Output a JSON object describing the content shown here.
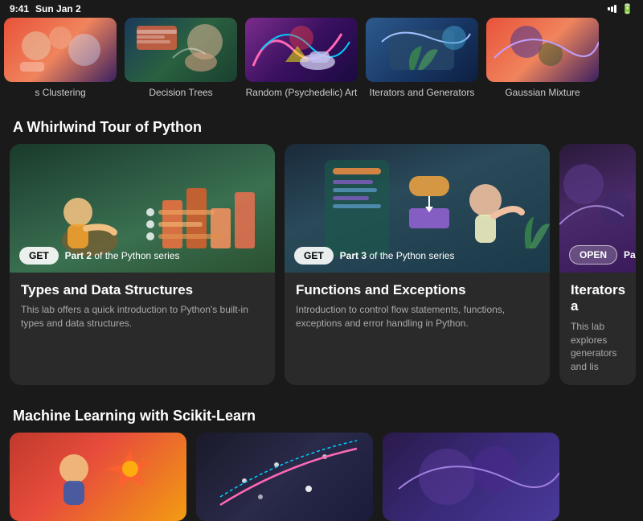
{
  "statusBar": {
    "time": "9:41",
    "date": "Sun Jan 2"
  },
  "topCards": [
    {
      "id": "clustering",
      "label": "s Clustering",
      "colorClass": "illus-1"
    },
    {
      "id": "decision-trees",
      "label": "Decision Trees",
      "colorClass": "illus-2"
    },
    {
      "id": "random-art",
      "label": "Random (Psychedelic) Art",
      "colorClass": "illus-3"
    },
    {
      "id": "iterators",
      "label": "Iterators and Generators",
      "colorClass": "illus-4"
    },
    {
      "id": "gaussian",
      "label": "Gaussian Mixture",
      "colorClass": "illus-1"
    }
  ],
  "sections": [
    {
      "id": "python-whirlwind",
      "title": "A Whirlwind Tour of Python",
      "cards": [
        {
          "id": "types-data",
          "colorClass": "illus-tds",
          "badgeType": "get",
          "badgeLabel": "GET",
          "seriesPart": "Part 2",
          "seriesName": "the Python series",
          "title": "Types and Data Structures",
          "desc": "This lab offers a quick introduction to Python's built-in types and data structures."
        },
        {
          "id": "functions-exceptions",
          "colorClass": "illus-fe",
          "badgeType": "get",
          "badgeLabel": "GET",
          "seriesPart": "Part 3",
          "seriesName": "the Python series",
          "title": "Functions and Exceptions",
          "desc": "Introduction to control flow statements, functions, exceptions and error handling in Python."
        },
        {
          "id": "iterators-partial",
          "colorClass": "illus-iter",
          "badgeType": "open",
          "badgeLabel": "OPEN",
          "seriesPart": "Par",
          "seriesName": "",
          "title": "Iterators a",
          "desc": "This lab explores generators and lis"
        }
      ]
    }
  ],
  "bottomSection": {
    "title": "Machine Learning with Scikit-Learn",
    "cards": [
      {
        "id": "ml1",
        "colorClass": "illus-ml1"
      },
      {
        "id": "ml2",
        "colorClass": "illus-ml2"
      },
      {
        "id": "ml3",
        "colorClass": "illus-ml3"
      }
    ]
  },
  "labels": {
    "get": "GET",
    "open": "OPEN",
    "of": "of"
  }
}
